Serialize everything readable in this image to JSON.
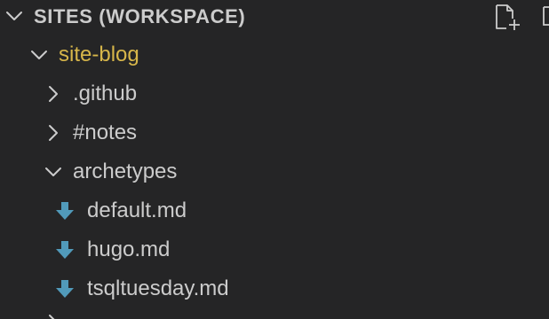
{
  "colors": {
    "background": "#252526",
    "text": "#cccccc",
    "folder_highlight": "#d7b64a",
    "markdown_icon": "#519aba"
  },
  "header": {
    "title": "SITES (WORKSPACE)",
    "actions": [
      {
        "icon": "new-file-icon"
      },
      {
        "icon": "new-folder-icon"
      }
    ]
  },
  "tree": {
    "root": {
      "label": "site-blog",
      "expanded": true,
      "icon": "chevron-down-icon"
    },
    "items": [
      {
        "label": ".github",
        "kind": "folder",
        "expanded": false,
        "icon": "chevron-right-icon"
      },
      {
        "label": "#notes",
        "kind": "folder",
        "expanded": false,
        "icon": "chevron-right-icon"
      },
      {
        "label": "archetypes",
        "kind": "folder",
        "expanded": true,
        "icon": "chevron-down-icon"
      },
      {
        "label": "default.md",
        "kind": "file",
        "icon": "markdown-file-icon"
      },
      {
        "label": "hugo.md",
        "kind": "file",
        "icon": "markdown-file-icon"
      },
      {
        "label": "tsqltuesday.md",
        "kind": "file",
        "icon": "markdown-file-icon"
      }
    ]
  }
}
